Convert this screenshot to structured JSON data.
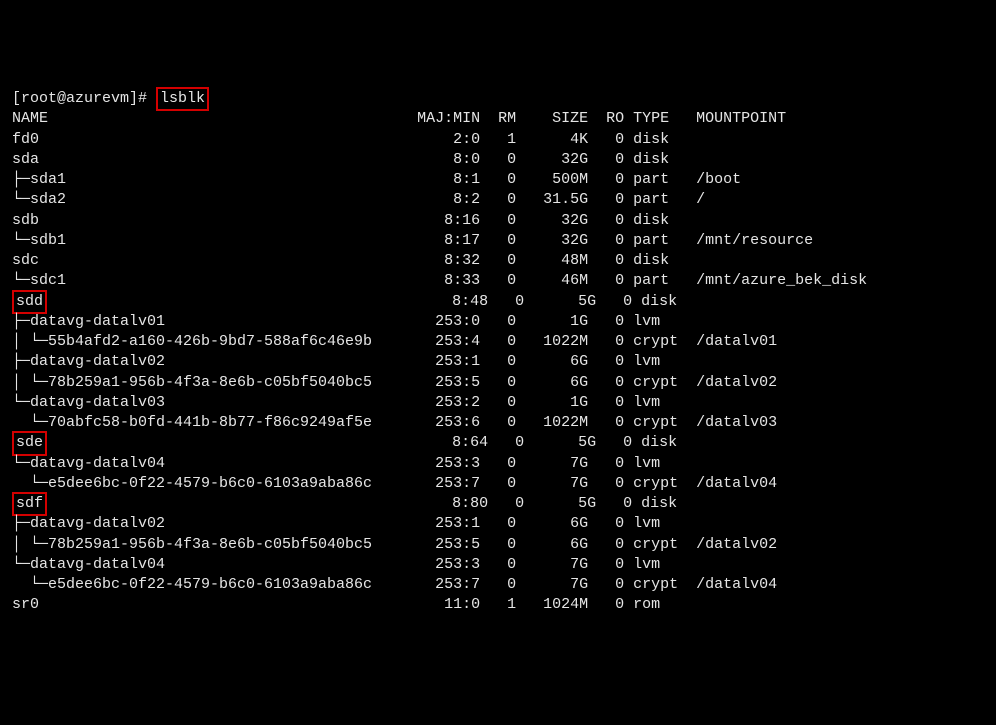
{
  "prompt": "[root@azurevm]#",
  "command": "lsblk",
  "header": {
    "name": "NAME",
    "majmin": "MAJ:MIN",
    "rm": "RM",
    "size": "SIZE",
    "ro": "RO",
    "type": "TYPE",
    "mount": "MOUNTPOINT"
  },
  "rows": [
    {
      "indent": 0,
      "tree": "",
      "name": "fd0",
      "hl": false,
      "maj": "2:0",
      "rm": "1",
      "size": "4K",
      "ro": "0",
      "type": "disk",
      "mount": ""
    },
    {
      "indent": 0,
      "tree": "",
      "name": "sda",
      "hl": false,
      "maj": "8:0",
      "rm": "0",
      "size": "32G",
      "ro": "0",
      "type": "disk",
      "mount": ""
    },
    {
      "indent": 1,
      "tree": "├─",
      "name": "sda1",
      "hl": false,
      "maj": "8:1",
      "rm": "0",
      "size": "500M",
      "ro": "0",
      "type": "part",
      "mount": "/boot"
    },
    {
      "indent": 1,
      "tree": "└─",
      "name": "sda2",
      "hl": false,
      "maj": "8:2",
      "rm": "0",
      "size": "31.5G",
      "ro": "0",
      "type": "part",
      "mount": "/"
    },
    {
      "indent": 0,
      "tree": "",
      "name": "sdb",
      "hl": false,
      "maj": "8:16",
      "rm": "0",
      "size": "32G",
      "ro": "0",
      "type": "disk",
      "mount": ""
    },
    {
      "indent": 1,
      "tree": "└─",
      "name": "sdb1",
      "hl": false,
      "maj": "8:17",
      "rm": "0",
      "size": "32G",
      "ro": "0",
      "type": "part",
      "mount": "/mnt/resource"
    },
    {
      "indent": 0,
      "tree": "",
      "name": "sdc",
      "hl": false,
      "maj": "8:32",
      "rm": "0",
      "size": "48M",
      "ro": "0",
      "type": "disk",
      "mount": ""
    },
    {
      "indent": 1,
      "tree": "└─",
      "name": "sdc1",
      "hl": false,
      "maj": "8:33",
      "rm": "0",
      "size": "46M",
      "ro": "0",
      "type": "part",
      "mount": "/mnt/azure_bek_disk"
    },
    {
      "indent": 0,
      "tree": "",
      "name": "sdd",
      "hl": true,
      "maj": "8:48",
      "rm": "0",
      "size": "5G",
      "ro": "0",
      "type": "disk",
      "mount": ""
    },
    {
      "indent": 1,
      "tree": "├─",
      "name": "datavg-datalv01",
      "hl": false,
      "maj": "253:0",
      "rm": "0",
      "size": "1G",
      "ro": "0",
      "type": "lvm",
      "mount": ""
    },
    {
      "indent": 2,
      "tree": "│ └─",
      "name": "55b4afd2-a160-426b-9bd7-588af6c46e9b",
      "hl": false,
      "maj": "253:4",
      "rm": "0",
      "size": "1022M",
      "ro": "0",
      "type": "crypt",
      "mount": "/datalv01"
    },
    {
      "indent": 1,
      "tree": "├─",
      "name": "datavg-datalv02",
      "hl": false,
      "maj": "253:1",
      "rm": "0",
      "size": "6G",
      "ro": "0",
      "type": "lvm",
      "mount": ""
    },
    {
      "indent": 2,
      "tree": "│ └─",
      "name": "78b259a1-956b-4f3a-8e6b-c05bf5040bc5",
      "hl": false,
      "maj": "253:5",
      "rm": "0",
      "size": "6G",
      "ro": "0",
      "type": "crypt",
      "mount": "/datalv02"
    },
    {
      "indent": 1,
      "tree": "└─",
      "name": "datavg-datalv03",
      "hl": false,
      "maj": "253:2",
      "rm": "0",
      "size": "1G",
      "ro": "0",
      "type": "lvm",
      "mount": ""
    },
    {
      "indent": 2,
      "tree": "  └─",
      "name": "70abfc58-b0fd-441b-8b77-f86c9249af5e",
      "hl": false,
      "maj": "253:6",
      "rm": "0",
      "size": "1022M",
      "ro": "0",
      "type": "crypt",
      "mount": "/datalv03"
    },
    {
      "indent": 0,
      "tree": "",
      "name": "sde",
      "hl": true,
      "maj": "8:64",
      "rm": "0",
      "size": "5G",
      "ro": "0",
      "type": "disk",
      "mount": ""
    },
    {
      "indent": 1,
      "tree": "└─",
      "name": "datavg-datalv04",
      "hl": false,
      "maj": "253:3",
      "rm": "0",
      "size": "7G",
      "ro": "0",
      "type": "lvm",
      "mount": ""
    },
    {
      "indent": 2,
      "tree": "  └─",
      "name": "e5dee6bc-0f22-4579-b6c0-6103a9aba86c",
      "hl": false,
      "maj": "253:7",
      "rm": "0",
      "size": "7G",
      "ro": "0",
      "type": "crypt",
      "mount": "/datalv04"
    },
    {
      "indent": 0,
      "tree": "",
      "name": "sdf",
      "hl": true,
      "maj": "8:80",
      "rm": "0",
      "size": "5G",
      "ro": "0",
      "type": "disk",
      "mount": ""
    },
    {
      "indent": 1,
      "tree": "├─",
      "name": "datavg-datalv02",
      "hl": false,
      "maj": "253:1",
      "rm": "0",
      "size": "6G",
      "ro": "0",
      "type": "lvm",
      "mount": ""
    },
    {
      "indent": 2,
      "tree": "│ └─",
      "name": "78b259a1-956b-4f3a-8e6b-c05bf5040bc5",
      "hl": false,
      "maj": "253:5",
      "rm": "0",
      "size": "6G",
      "ro": "0",
      "type": "crypt",
      "mount": "/datalv02"
    },
    {
      "indent": 1,
      "tree": "└─",
      "name": "datavg-datalv04",
      "hl": false,
      "maj": "253:3",
      "rm": "0",
      "size": "7G",
      "ro": "0",
      "type": "lvm",
      "mount": ""
    },
    {
      "indent": 2,
      "tree": "  └─",
      "name": "e5dee6bc-0f22-4579-b6c0-6103a9aba86c",
      "hl": false,
      "maj": "253:7",
      "rm": "0",
      "size": "7G",
      "ro": "0",
      "type": "crypt",
      "mount": "/datalv04"
    },
    {
      "indent": 0,
      "tree": "",
      "name": "sr0",
      "hl": false,
      "maj": "11:0",
      "rm": "1",
      "size": "1024M",
      "ro": "0",
      "type": "rom",
      "mount": ""
    }
  ],
  "cols": {
    "name_w": 44,
    "maj_w": 8,
    "rm_w": 3,
    "size_w": 7,
    "ro_w": 3,
    "type_w": 6
  }
}
